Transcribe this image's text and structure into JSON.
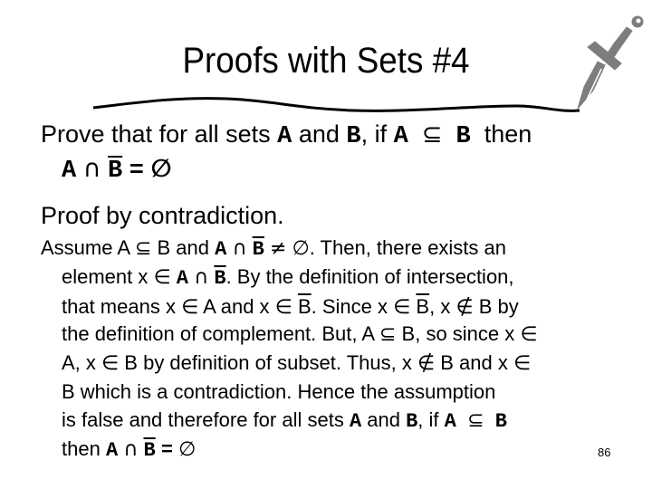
{
  "slide": {
    "title": "Proofs with Sets #4",
    "page_number": "86",
    "decoration_icon": "sword-icon"
  },
  "statement": {
    "line1": {
      "t1": "Prove that for all sets ",
      "A": "A",
      "t2": " and ",
      "B": "B",
      "t3": ", if ",
      "A2": "A",
      "subset": "⊆",
      "B2": "B",
      "t4": " then"
    },
    "line2": {
      "A": "A",
      "cap": "∩",
      "Bbar": "B",
      "eq": "=",
      "empty": "∅"
    }
  },
  "method": "Proof by contradiction.",
  "proof": {
    "l1": {
      "a": "Assume A ",
      "subset": "⊆",
      "b": " B and ",
      "A": "A",
      "cap": "∩",
      "Bbar": "B",
      "neq": "≠",
      "empty": "∅",
      "c": ". Then, there exists an"
    },
    "l2": {
      "a": "element x ",
      "in": "∈",
      "A": "A",
      "cap": "∩",
      "Bbar": "B",
      "b": ". By the definition of intersection,"
    },
    "l3": {
      "a": "that means x ",
      "in": "∈",
      "b": " A and x ",
      "in2": "∈",
      "Bbar": "B",
      "c": ".  Since x ",
      "in3": "∈",
      "Bbar2": "B",
      "d": ", x ",
      "notin": "∉",
      "e": " B by"
    },
    "l4": {
      "a": "the definition of complement. But, A ",
      "subset": "⊆",
      "b": " B, so since x  ",
      "in": "∈"
    },
    "l5": {
      "a": "A, x ",
      "in": "∈",
      "b": " B by definition of subset.  Thus, x ",
      "notin": "∉",
      "c": " B and x ",
      "in2": "∈"
    },
    "l6": {
      "a": "B which is a contradiction.  Hence the assumption"
    },
    "l7": {
      "a": "is false and therefore for all sets ",
      "A": "A",
      "b": " and ",
      "B": "B",
      "c": ", if ",
      "A2": "A",
      "subset": "⊆",
      "B2": "B"
    },
    "l8": {
      "a": "then ",
      "A": "A",
      "cap": "∩",
      "Bbar": "B",
      "eq": "=",
      "empty": "∅"
    }
  }
}
